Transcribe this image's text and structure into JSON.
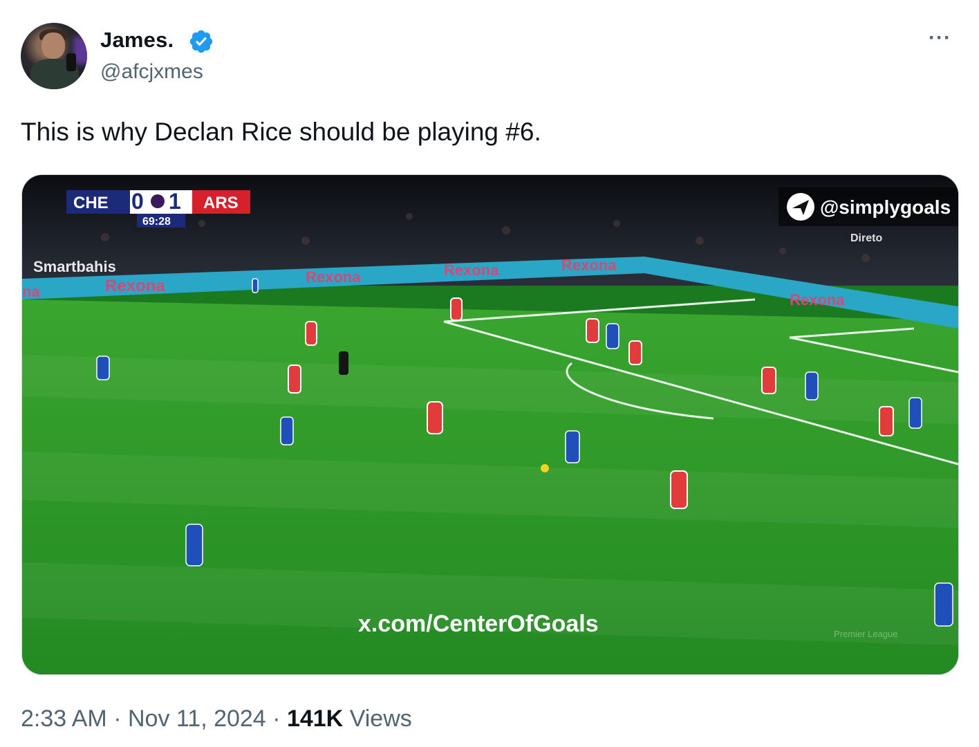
{
  "author": {
    "display_name": "James.",
    "handle": "@afcjxmes",
    "verified_icon": "verified-badge-icon",
    "colors": {
      "verified": "#1d9bf0"
    }
  },
  "more_icon": "more-options-icon",
  "tweet": {
    "text": "This is why Declan Rice should be playing #6."
  },
  "media": {
    "type": "video-frame",
    "scoreboard": {
      "home_team": "CHE",
      "home_score": "0",
      "away_score": "1",
      "away_team": "ARS",
      "clock": "69:28"
    },
    "overlays": {
      "brand_handle": "@simplygoals",
      "live_label": "Direto",
      "sponsor_board_left": "Smartbahis",
      "ad_text": "Rexona",
      "ad_fragment_left": "na",
      "watermark": "x.com/CenterOfGoals",
      "league_mark": "Premier League"
    },
    "colors": {
      "pitch": "#2f9a2a",
      "home_kit": "#1f4fb8",
      "away_kit": "#e23b3b",
      "ad_board": "#2aa7c6"
    }
  },
  "footer": {
    "time": "2:33 AM",
    "separator": "·",
    "date": "Nov 11, 2024",
    "views_count": "141K",
    "views_label": "Views"
  }
}
